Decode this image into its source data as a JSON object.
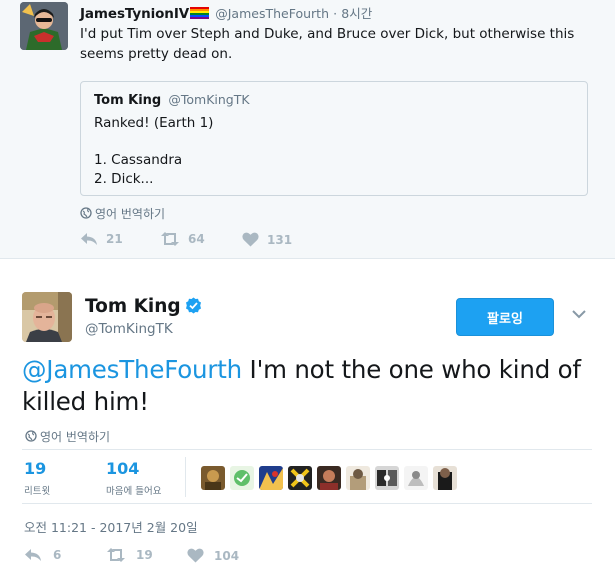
{
  "parent_tweet": {
    "display_name": "JamesTynionIV",
    "handle": "@JamesTheFourth",
    "separator": "·",
    "time": "8시간",
    "text": "I'd put Tim over Steph and Duke, and Bruce over Dick, but otherwise this seems pretty dead on.",
    "quoted": {
      "display_name": "Tom King",
      "handle": "@TomKingTK",
      "line1": "Ranked! (Earth 1)",
      "line2": "1. Cassandra",
      "line3": "2. Dick..."
    },
    "translate_label": "영어 번역하기",
    "actions": {
      "replies": "21",
      "retweets": "64",
      "likes": "131"
    }
  },
  "main_tweet": {
    "display_name": "Tom King",
    "handle": "@TomKingTK",
    "follow_label": "팔로잉",
    "mention": "@JamesTheFourth",
    "text_rest": " I'm not the one who kind of killed him!",
    "translate_label": "영어 번역하기",
    "stats": {
      "retweets_count": "19",
      "retweets_label": "리트윗",
      "likes_count": "104",
      "likes_label": "마음에 들어요"
    },
    "liker_avatar_count": 9,
    "timestamp": "오전 11:21 - 2017년 2월 20일",
    "actions": {
      "replies": "6",
      "retweets": "19",
      "likes": "104"
    }
  },
  "colors": {
    "accent": "#1da1f2",
    "link": "#1b95e0",
    "muted": "#657786",
    "action_gray": "#aab8c2",
    "parent_bg": "#f5f8fa"
  },
  "icons": {
    "reply": "reply-icon",
    "retweet": "retweet-icon",
    "like": "heart-icon",
    "translate": "globe-icon",
    "verified": "verified-badge-icon",
    "more": "chevron-down-icon"
  }
}
